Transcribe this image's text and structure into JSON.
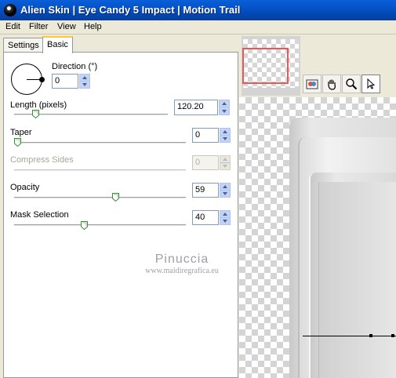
{
  "window": {
    "title": "Alien Skin  |  Eye Candy 5 Impact  |  Motion Trail"
  },
  "menu": {
    "items": [
      "Edit",
      "Filter",
      "View",
      "Help"
    ]
  },
  "tabs": [
    {
      "label": "Settings",
      "active": false
    },
    {
      "label": "Basic",
      "active": true
    }
  ],
  "controls": {
    "direction": {
      "label": "Direction (°)",
      "value": "0"
    },
    "length": {
      "label": "Length (pixels)",
      "value": "120.20",
      "slider": 0.16
    },
    "taper": {
      "label": "Taper",
      "value": "0",
      "slider": 0.0
    },
    "compress_sides": {
      "label": "Compress Sides",
      "value": "0",
      "enabled": false
    },
    "opacity": {
      "label": "Opacity",
      "value": "59",
      "slider": 0.59
    },
    "mask_selection": {
      "label": "Mask Selection",
      "value": "40",
      "slider": 0.4
    }
  },
  "watermark": {
    "title": "Pinuccia",
    "url": "www.maidiregrafica.eu"
  },
  "tools": [
    {
      "icon": "preview-toggle-icon"
    },
    {
      "icon": "hand-icon"
    },
    {
      "icon": "zoom-icon"
    },
    {
      "icon": "pointer-icon"
    }
  ],
  "colors": {
    "titlebar": "#0552c7",
    "navigator_rect": "#e35a5a",
    "spin_button": "#c1d3fb"
  }
}
